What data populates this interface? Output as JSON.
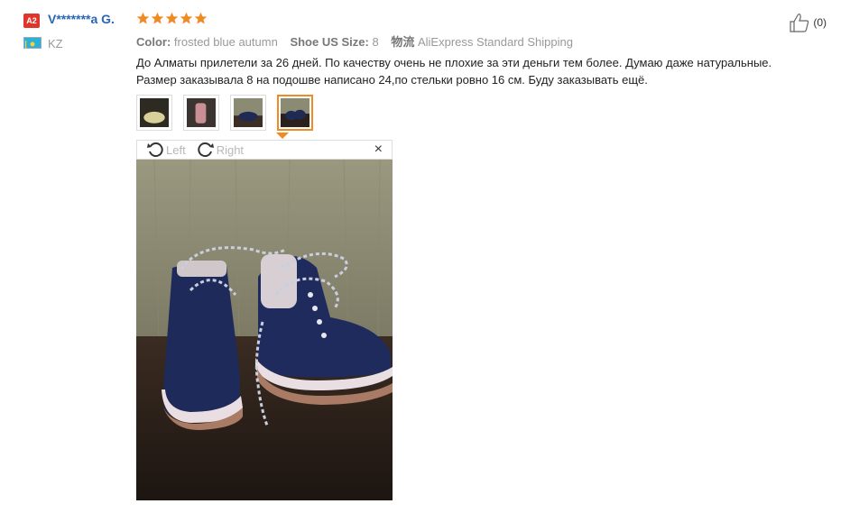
{
  "review": {
    "avatar_badge": "A2",
    "username": "V*******a G.",
    "rating": 5,
    "country": "KZ",
    "color_label": "Color:",
    "color_value": "frosted blue autumn",
    "size_label": "Shoe US Size:",
    "size_value": "8",
    "shipping_label": "物流",
    "shipping_value": "AliExpress Standard Shipping",
    "text_line1": "До Алматы прилетели за 26 дней. По качеству очень не плохие за эти деньги тем более. Думаю даже натуральные.",
    "text_line2": "Размер заказывала 8 на подошве написано 24,по стельки ровно 16 см. Буду заказывать ещё.",
    "likes": "(0)"
  },
  "thumbnails": [
    {
      "id": "thumb-1",
      "active": false
    },
    {
      "id": "thumb-2",
      "active": false
    },
    {
      "id": "thumb-3",
      "active": false
    },
    {
      "id": "thumb-4",
      "active": true
    }
  ],
  "viewer": {
    "rotate_left_label": "Left",
    "rotate_right_label": "Right",
    "close_symbol": "×"
  },
  "colors": {
    "username": "#2a66b5",
    "star": "#f08a24",
    "badge": "#e0352b",
    "active_thumb": "#f08a24"
  },
  "icons": [
    "star-icon",
    "flag-icon",
    "thumbs-up-icon",
    "rotate-left-icon",
    "rotate-right-icon",
    "close-icon"
  ]
}
